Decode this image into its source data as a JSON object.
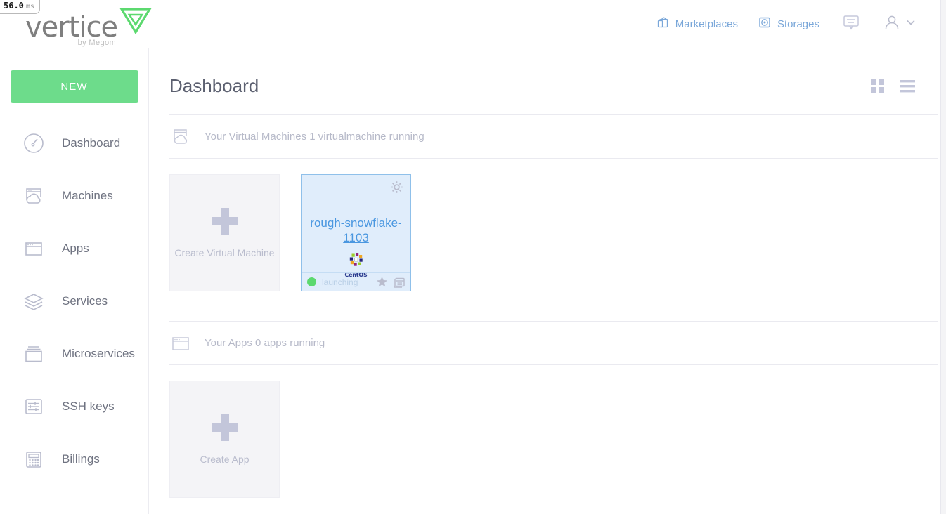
{
  "perf": {
    "value": "56.0",
    "unit": "ms"
  },
  "brand": {
    "name": "vertice",
    "tagline": "by Megom",
    "mark": "triangle-logo"
  },
  "header": {
    "nav": [
      {
        "label": "Marketplaces",
        "icon": "marketplace-bag-icon"
      },
      {
        "label": "Storages",
        "icon": "storage-disk-icon"
      }
    ],
    "messages_icon": "message-bubble-icon",
    "user_icon": "user-avatar-icon",
    "user_chevron_icon": "chevron-down-icon"
  },
  "sidebar": {
    "new_button": "NEW",
    "items": [
      {
        "label": "Dashboard",
        "icon": "gauge-icon"
      },
      {
        "label": "Machines",
        "icon": "cloud-machine-icon"
      },
      {
        "label": "Apps",
        "icon": "window-icon"
      },
      {
        "label": "Services",
        "icon": "layers-icon"
      },
      {
        "label": "Microservices",
        "icon": "stacked-window-icon"
      },
      {
        "label": "SSH keys",
        "icon": "sliders-icon"
      },
      {
        "label": "Billings",
        "icon": "calculator-icon"
      }
    ]
  },
  "main": {
    "title": "Dashboard",
    "view_toggles": [
      {
        "name": "grid-view",
        "icon": "grid-icon"
      },
      {
        "name": "list-view",
        "icon": "list-icon"
      }
    ],
    "sections": [
      {
        "id": "virtual-machines",
        "icon": "cloud-machine-icon",
        "label": "Your Virtual Machines 1 virtualmachine running",
        "create_tile": {
          "label": "Create Virtual Machine",
          "icon": "plus-icon"
        },
        "cards": [
          {
            "name": "rough-snowflake-1103",
            "os": "CentOS",
            "os_icon": "centos-logo",
            "status": "launching",
            "status_color": "#5cd96f",
            "gear_icon": "gear-icon",
            "favorite_icon": "star-icon",
            "console_icon": "terminal-icon"
          }
        ]
      },
      {
        "id": "apps",
        "icon": "window-icon",
        "label": "Your Apps 0 apps running",
        "create_tile": {
          "label": "Create App",
          "icon": "plus-icon"
        },
        "cards": []
      }
    ]
  },
  "colors": {
    "accent_green": "#6ddc8b",
    "link_blue": "#4a97e0",
    "card_bg": "#e0edfb",
    "card_border": "#8fc0ea",
    "nav_blue": "#7aa7d9",
    "muted": "#b7bac9"
  }
}
